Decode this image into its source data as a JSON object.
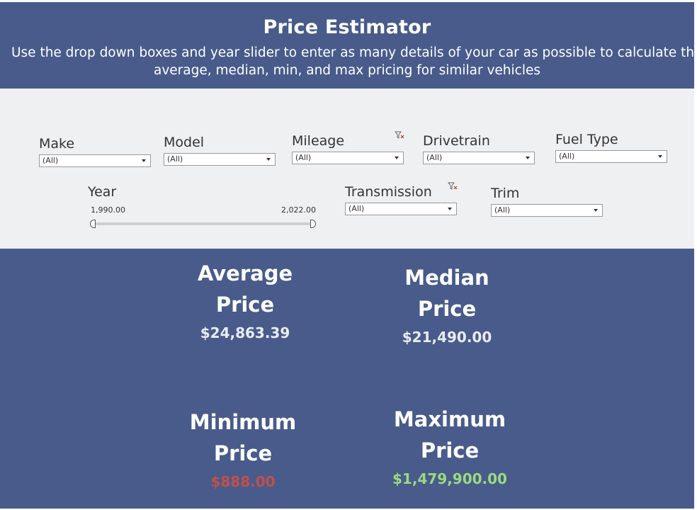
{
  "header": {
    "title": "Price Estimator",
    "subtitle_line1": "Use the drop down boxes and year slider to enter as many details of your car as possible to calculate th",
    "subtitle_line2": "average, median, min, and max  pricing for similar vehicles"
  },
  "filters": {
    "make": {
      "label": "Make",
      "value": "(All)"
    },
    "model": {
      "label": "Model",
      "value": "(All)"
    },
    "mileage": {
      "label": "Mileage",
      "value": "(All)"
    },
    "drivetrain": {
      "label": "Drivetrain",
      "value": "(All)"
    },
    "fuel_type": {
      "label": "Fuel Type",
      "value": "(All)"
    },
    "transmission": {
      "label": "Transmission",
      "value": "(All)"
    },
    "trim": {
      "label": "Trim",
      "value": "(All)"
    },
    "year": {
      "label": "Year",
      "min_label": "1,990.00",
      "max_label": "2,022.00",
      "min": 1990,
      "max": 2022
    }
  },
  "stats": {
    "average": {
      "line1": "Average",
      "line2": "Price",
      "value": "$24,863.39",
      "color": "#e8ecf5"
    },
    "median": {
      "line1": "Median",
      "line2": "Price",
      "value": "$21,490.00",
      "color": "#e8ecf5"
    },
    "minimum": {
      "line1": "Minimum",
      "line2": "Price",
      "value": "$888.00",
      "color": "#c0504d"
    },
    "maximum": {
      "line1": "Maximum",
      "line2": "Price",
      "value": "$1,479,900.00",
      "color": "#9bd982"
    }
  },
  "colors": {
    "panel_blue": "#485b8a",
    "filter_bg": "#eff0f2"
  }
}
